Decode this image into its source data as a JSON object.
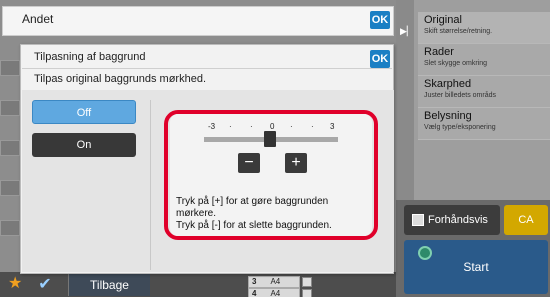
{
  "dialog_outer": {
    "title": "Andet",
    "ok_label": "OK"
  },
  "dialog": {
    "title": "Tilpasning af baggrund",
    "ok_label": "OK",
    "subtitle": "Tilpas original baggrunds mørkhed.",
    "options": {
      "off": "Off",
      "on": "On"
    },
    "selected_option": "Off",
    "slider": {
      "labels": [
        "-3",
        "·",
        "·",
        "0",
        "·",
        "·",
        "3"
      ],
      "min": -3,
      "max": 3,
      "value": 0
    },
    "minus_label": "−",
    "plus_label": "+",
    "description_line1": "Tryk på [+] for at gøre baggrunden",
    "description_line2": "mørkere.",
    "description_line3": "Tryk på [-] for at slette baggrunden."
  },
  "right_menu": [
    {
      "title": "Original",
      "subtitle": "Skift størrelse/retning."
    },
    {
      "title": "Rader",
      "subtitle": "Slet skygge omkring"
    },
    {
      "title": "Skarphed",
      "subtitle": "Juster billedets områds"
    },
    {
      "title": "Belysning",
      "subtitle": "Vælg type/eksponering"
    }
  ],
  "actions": {
    "preview": "Forhåndsvis",
    "ca": "CA",
    "start": "Start"
  },
  "bottom_bar": {
    "back": "Tilbage",
    "star_icon": "star-icon",
    "check_icon": "check-icon"
  },
  "mini_rows": [
    {
      "n": "3",
      "size": "A4"
    },
    {
      "n": "4",
      "size": "A4"
    }
  ],
  "colors": {
    "ok_blue": "#1a7fc4",
    "selected_blue": "#5fa8e0",
    "highlight_red": "#e0002a",
    "ca_yellow": "#d3a800",
    "start_blue": "#2a5a8a"
  }
}
